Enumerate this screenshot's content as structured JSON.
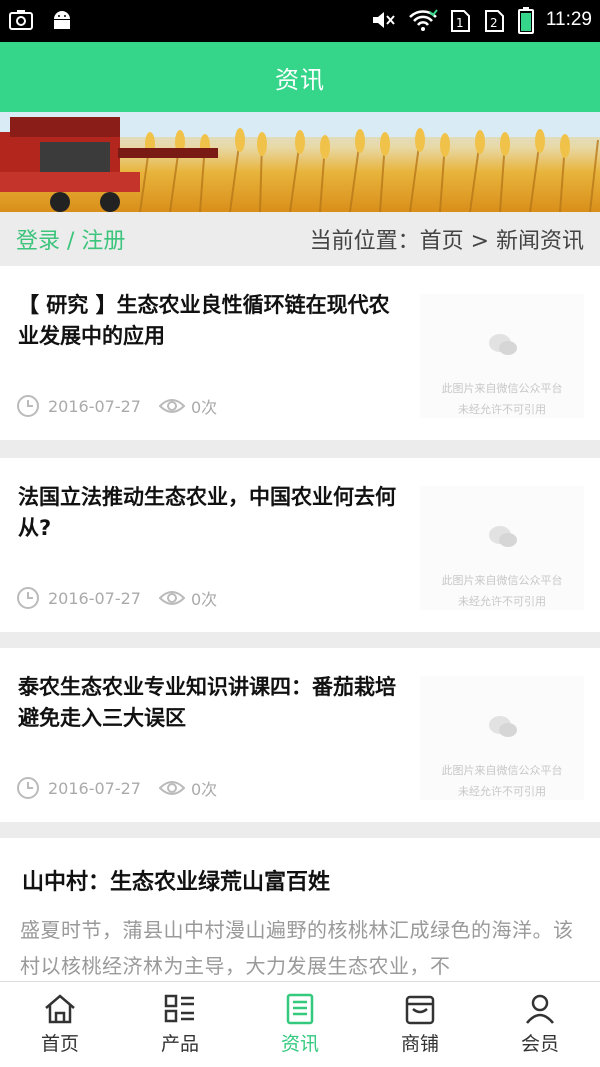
{
  "status_bar": {
    "time": "11:29"
  },
  "header": {
    "title": "资讯"
  },
  "breadcrumb": {
    "login_register": "登录 / 注册",
    "location": "当前位置：首页 > 新闻资讯"
  },
  "news": [
    {
      "title": "【 研究 】生态农业良性循环链在现代农业发展中的应用",
      "date": "2016-07-27",
      "views": "0次",
      "thumb_line1": "此图片来自微信公众平台",
      "thumb_line2": "未经允许不可引用"
    },
    {
      "title": "法国立法推动生态农业，中国农业何去何从?",
      "date": "2016-07-27",
      "views": "0次",
      "thumb_line1": "此图片来自微信公众平台",
      "thumb_line2": "未经允许不可引用"
    },
    {
      "title": "泰农生态农业专业知识讲课四：番茄栽培避免走入三大误区",
      "date": "2016-07-27",
      "views": "0次",
      "thumb_line1": "此图片来自微信公众平台",
      "thumb_line2": "未经允许不可引用"
    }
  ],
  "article": {
    "title": "山中村：生态农业绿荒山富百姓",
    "body": "盛夏时节，蒲县山中村漫山遍野的核桃林汇成绿色的海洋。该村以核桃经济林为主导，大力发展生态农业，不"
  },
  "tabs": [
    {
      "label": "首页",
      "icon": "home-icon",
      "active": false
    },
    {
      "label": "产品",
      "icon": "grid-list-icon",
      "active": false
    },
    {
      "label": "资讯",
      "icon": "news-icon",
      "active": true
    },
    {
      "label": "商铺",
      "icon": "shop-icon",
      "active": false
    },
    {
      "label": "会员",
      "icon": "user-icon",
      "active": false
    }
  ],
  "colors": {
    "brand_green": "#35d68a",
    "active_tab": "#35c97f",
    "login_green": "#3cc47c"
  }
}
